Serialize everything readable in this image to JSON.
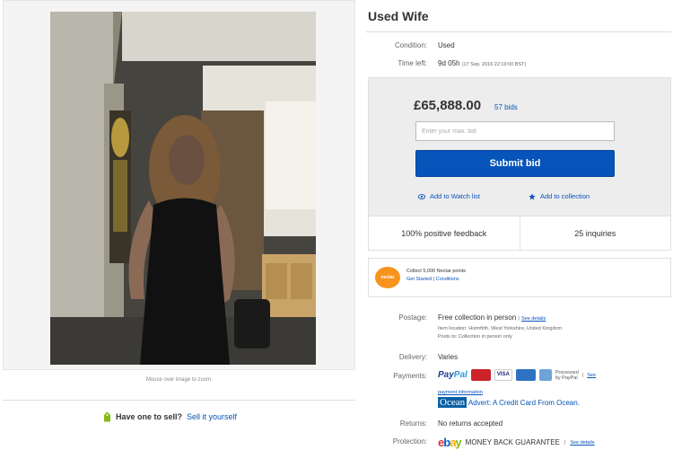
{
  "photo": {
    "zoom_hint": "Mouse over image to zoom"
  },
  "sell": {
    "question": "Have one to sell?",
    "link": "Sell it yourself"
  },
  "listing": {
    "title": "Used Wife",
    "condition_label": "Condition:",
    "condition_value": "Used",
    "time_left_label": "Time left:",
    "time_left_value": "9d 05h",
    "time_left_detail": "(17 Sep. 2016   22:19:00 BST)"
  },
  "bid": {
    "price": "£65,888.00",
    "bids": "57 bids",
    "input_placeholder": "Enter your max. bid",
    "submit_label": "Submit bid",
    "watch_label": "Add to Watch list",
    "collection_label": "Add to collection"
  },
  "stats": {
    "feedback": "100% positive feedback",
    "inquiries": "25 inquiries"
  },
  "nectar": {
    "badge": "nectar",
    "line1": "Collect 5,000 Nectar points",
    "get_started": "Get Started",
    "sep": "|",
    "conditions": "Conditions"
  },
  "postage": {
    "label": "Postage:",
    "value": "Free collection in person",
    "sep": "|",
    "details_link": "See details",
    "location": "Item location:  Holmfirth, West Yorkshire, United Kingdom",
    "posts_to": "Posts to:  Collection in person only"
  },
  "delivery": {
    "label": "Delivery:",
    "value": "Varies"
  },
  "payments": {
    "label": "Payments:",
    "paypal_1": "Pay",
    "paypal_2": "Pal",
    "visa": "VISA",
    "processed": "Processed",
    "by_paypal": "by PayPal",
    "sep": "|",
    "see": "See",
    "payment_info": "payment information",
    "ocean": "Ocean",
    "ocean_text": "Advert: A Credit Card From Ocean."
  },
  "returns": {
    "label": "Returns:",
    "value": "No returns accepted"
  },
  "protection": {
    "label": "Protection:",
    "e": "e",
    "b": "b",
    "a": "a",
    "y": "y",
    "guarantee": "MONEY BACK GUARANTEE",
    "sep": "|",
    "details_link": "See details"
  },
  "colors": {
    "link": "#0654ba",
    "submit": "#0654ba",
    "panel": "#ededed",
    "nectar": "#f7941d"
  }
}
